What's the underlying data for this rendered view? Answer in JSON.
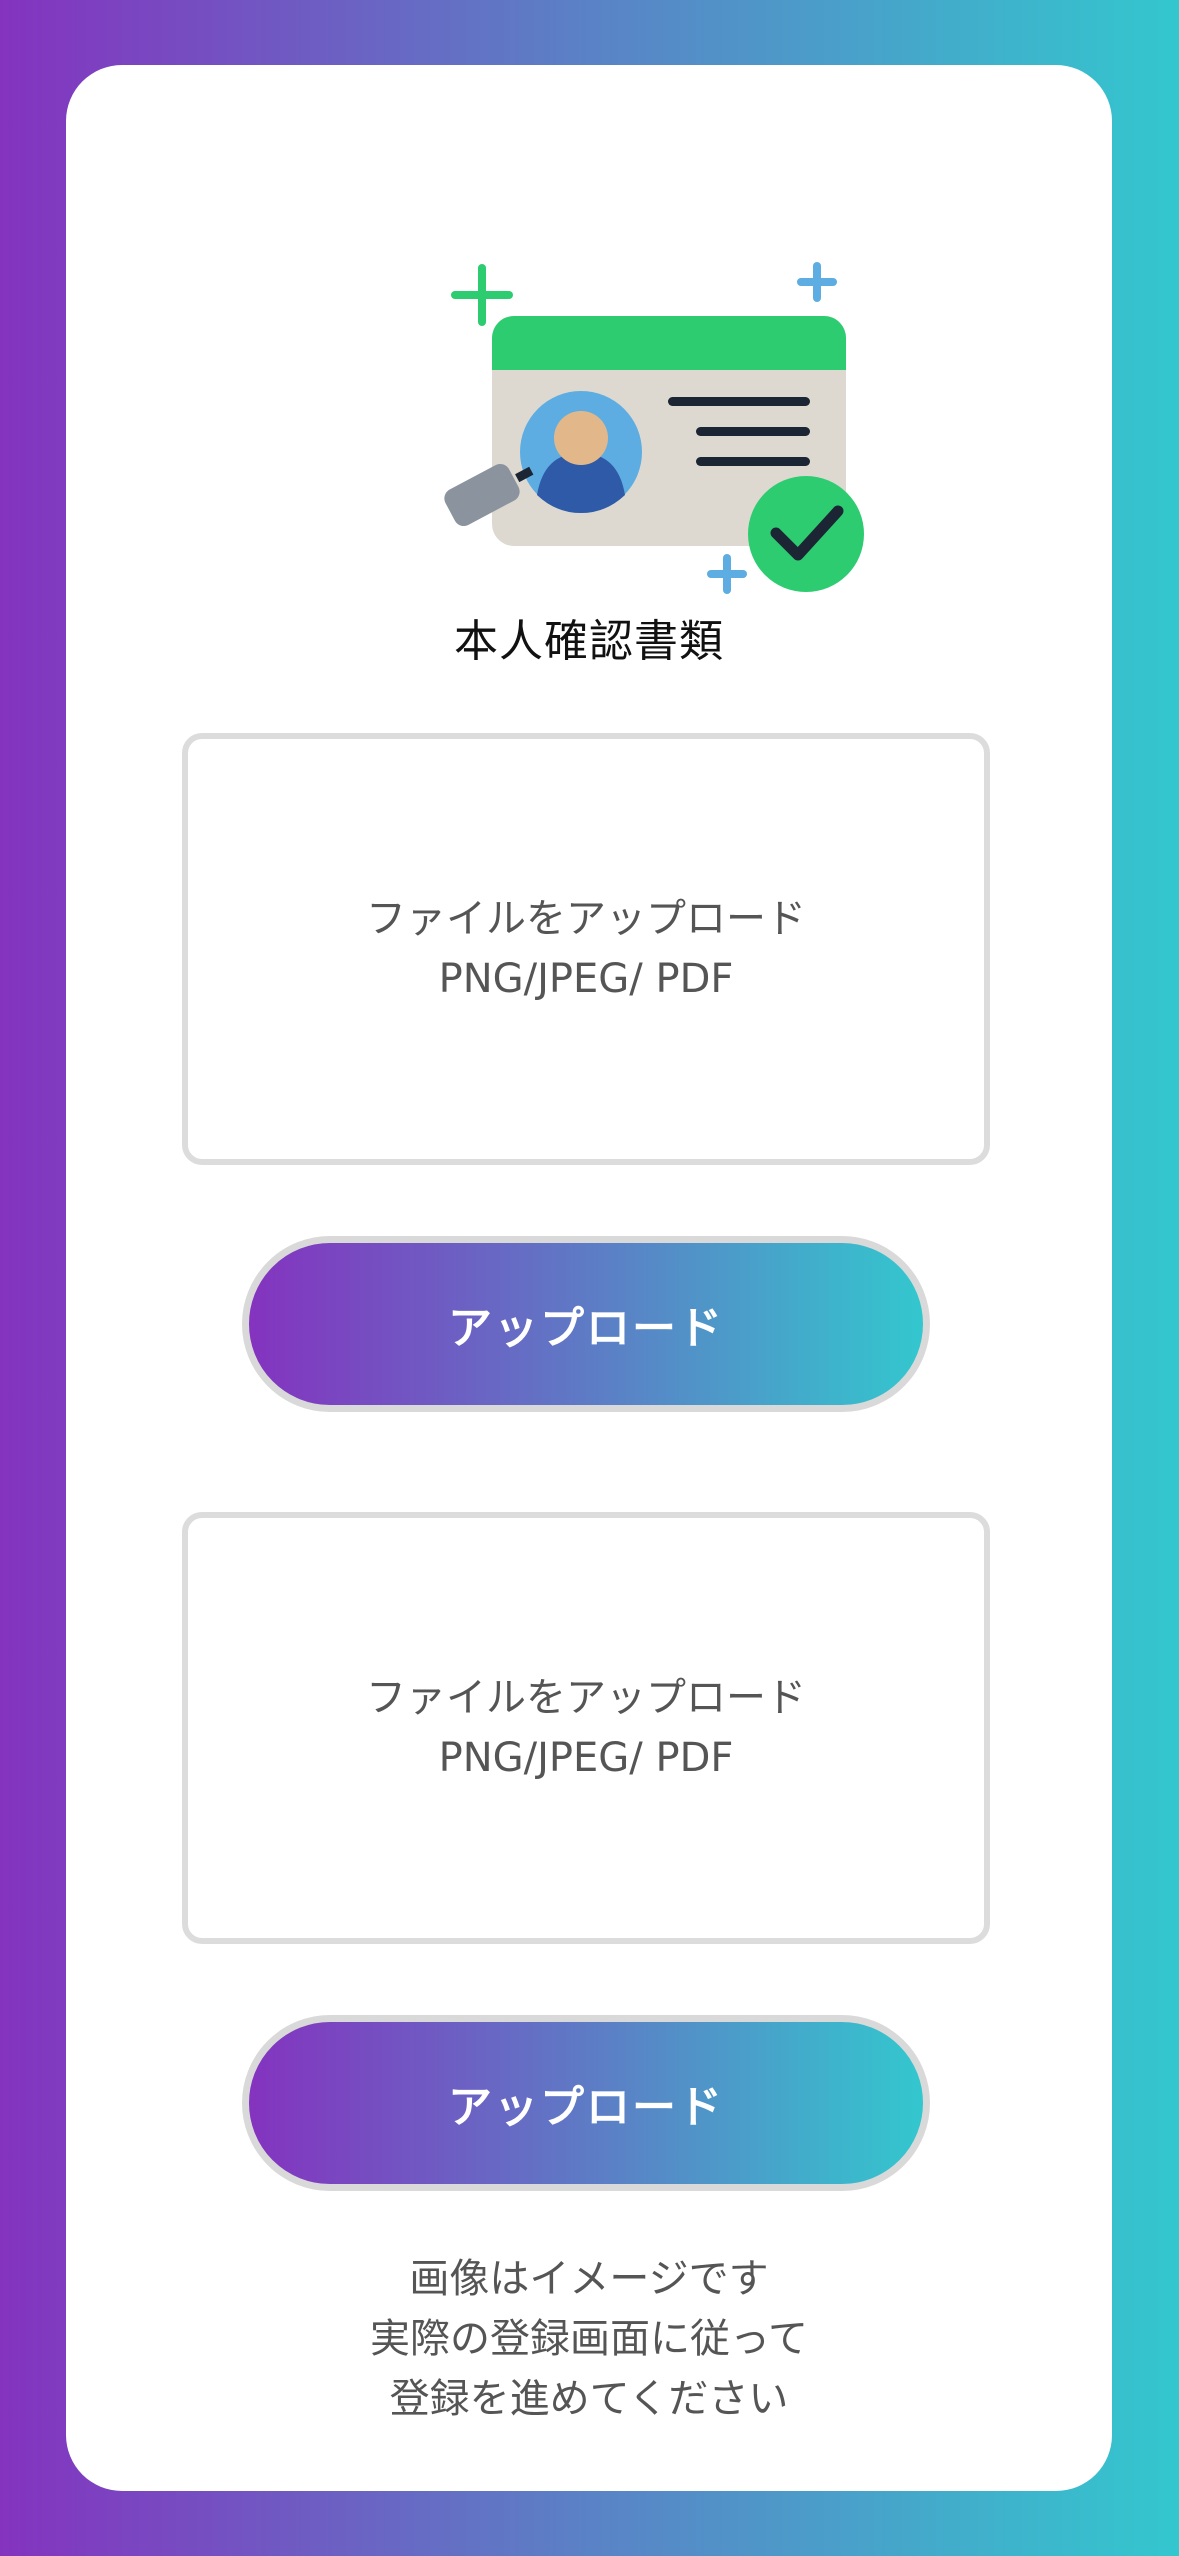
{
  "title": "本人確認書類",
  "uploads": [
    {
      "line1": "ファイルをアップロード",
      "line2": "PNG/JPEG/ PDF",
      "button": "アップロード"
    },
    {
      "line1": "ファイルをアップロード",
      "line2": "PNG/JPEG/ PDF",
      "button": "アップロード"
    }
  ],
  "note": {
    "line1": "画像はイメージです",
    "line2": "実際の登録画面に従って",
    "line3": "登録を進めてください"
  },
  "illustration": {
    "icon": "id-card-verified-icon"
  },
  "colors": {
    "gradient_start": "#8433BF",
    "gradient_end": "#33C7CE",
    "accent_green": "#2ECC71"
  }
}
